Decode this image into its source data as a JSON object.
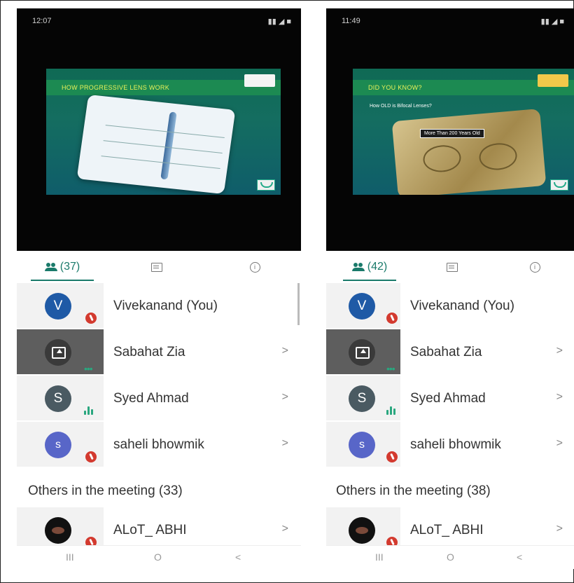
{
  "screens": [
    {
      "status_time": "12:07",
      "slide_title": "HOW PROGRESSIVE LENS WORK",
      "participants_tab": "(37)",
      "participants": [
        {
          "initial": "V",
          "name": "Vivekanand (You)",
          "color": "#1f5aa6"
        },
        {
          "initial": "",
          "name": "Sabahat Zia",
          "color": "#3a3a3a"
        },
        {
          "initial": "S",
          "name": "Syed Ahmad",
          "color": "#4a5a62"
        },
        {
          "initial": "s",
          "name": "saheli bhowmik",
          "color": "#5866c8"
        }
      ],
      "others_label": "Others in the meeting (33)",
      "other_participant": {
        "name": "ALoT_ ABHI"
      }
    },
    {
      "status_time": "11:49",
      "slide_title": "DID YOU KNOW?",
      "slide_subtitle": "How OLD is Bifocal Lenses?",
      "slide_callout": "More Than 200 Years Old",
      "participants_tab": "(42)",
      "participants": [
        {
          "initial": "V",
          "name": "Vivekanand (You)",
          "color": "#1f5aa6"
        },
        {
          "initial": "",
          "name": "Sabahat Zia",
          "color": "#3a3a3a"
        },
        {
          "initial": "S",
          "name": "Syed Ahmad",
          "color": "#4a5a62"
        },
        {
          "initial": "s",
          "name": "saheli bhowmik",
          "color": "#5866c8"
        }
      ],
      "others_label": "Others in the meeting (38)",
      "other_participant": {
        "name": "ALoT_ ABHI"
      }
    }
  ],
  "nav": {
    "recents": "III",
    "home": "O",
    "back": "<"
  },
  "chevron": ">"
}
